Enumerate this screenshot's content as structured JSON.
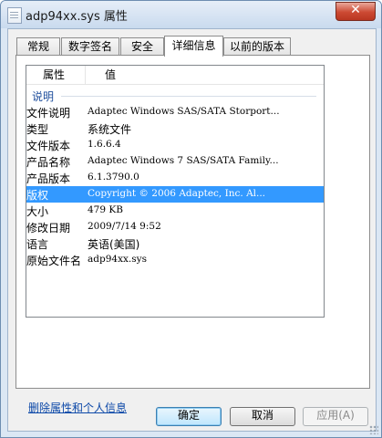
{
  "window": {
    "title": "adp94xx.sys 属性",
    "close_label": "✕"
  },
  "tabs": [
    {
      "label": "常规"
    },
    {
      "label": "数字签名"
    },
    {
      "label": "安全"
    },
    {
      "label": "详细信息",
      "active": true
    },
    {
      "label": "以前的版本"
    }
  ],
  "table": {
    "col_property": "属性",
    "col_value": "值",
    "group": "说明",
    "rows": [
      {
        "k": "文件说明",
        "v": "Adaptec Windows SAS/SATA Storport..."
      },
      {
        "k": "类型",
        "v": "系统文件"
      },
      {
        "k": "文件版本",
        "v": "1.6.6.4"
      },
      {
        "k": "产品名称",
        "v": "Adaptec Windows 7 SAS/SATA Family..."
      },
      {
        "k": "产品版本",
        "v": "6.1.3790.0"
      },
      {
        "k": "版权",
        "v": "Copyright © 2006 Adaptec, Inc. Al...",
        "selected": true
      },
      {
        "k": "大小",
        "v": "479 KB"
      },
      {
        "k": "修改日期",
        "v": "2009/7/14 9:52"
      },
      {
        "k": "语言",
        "v": "英语(美国)"
      },
      {
        "k": "原始文件名",
        "v": "adp94xx.sys"
      }
    ]
  },
  "remove_link": "删除属性和个人信息",
  "buttons": {
    "ok": "确定",
    "cancel": "取消",
    "apply": "应用(A)"
  },
  "colors": {
    "selection": "#3399ff",
    "link": "#0c48a8",
    "group": "#1e4e9c"
  }
}
